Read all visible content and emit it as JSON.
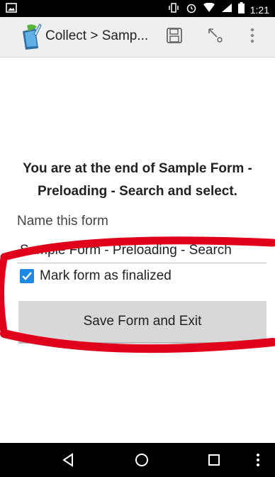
{
  "status_bar": {
    "time": "1:21"
  },
  "app_bar": {
    "title": "Collect > Samp..."
  },
  "main": {
    "end_message": "You are at the end of Sample Form - Preloading - Search and select.",
    "name_label": "Name this form",
    "name_value": "Sample Form - Preloading - Search",
    "finalize_label": "Mark form as finalized",
    "finalize_checked": true,
    "save_button_label": "Save Form and Exit"
  },
  "colors": {
    "accent": "#1e88e5",
    "annotation": "#e0001b"
  }
}
